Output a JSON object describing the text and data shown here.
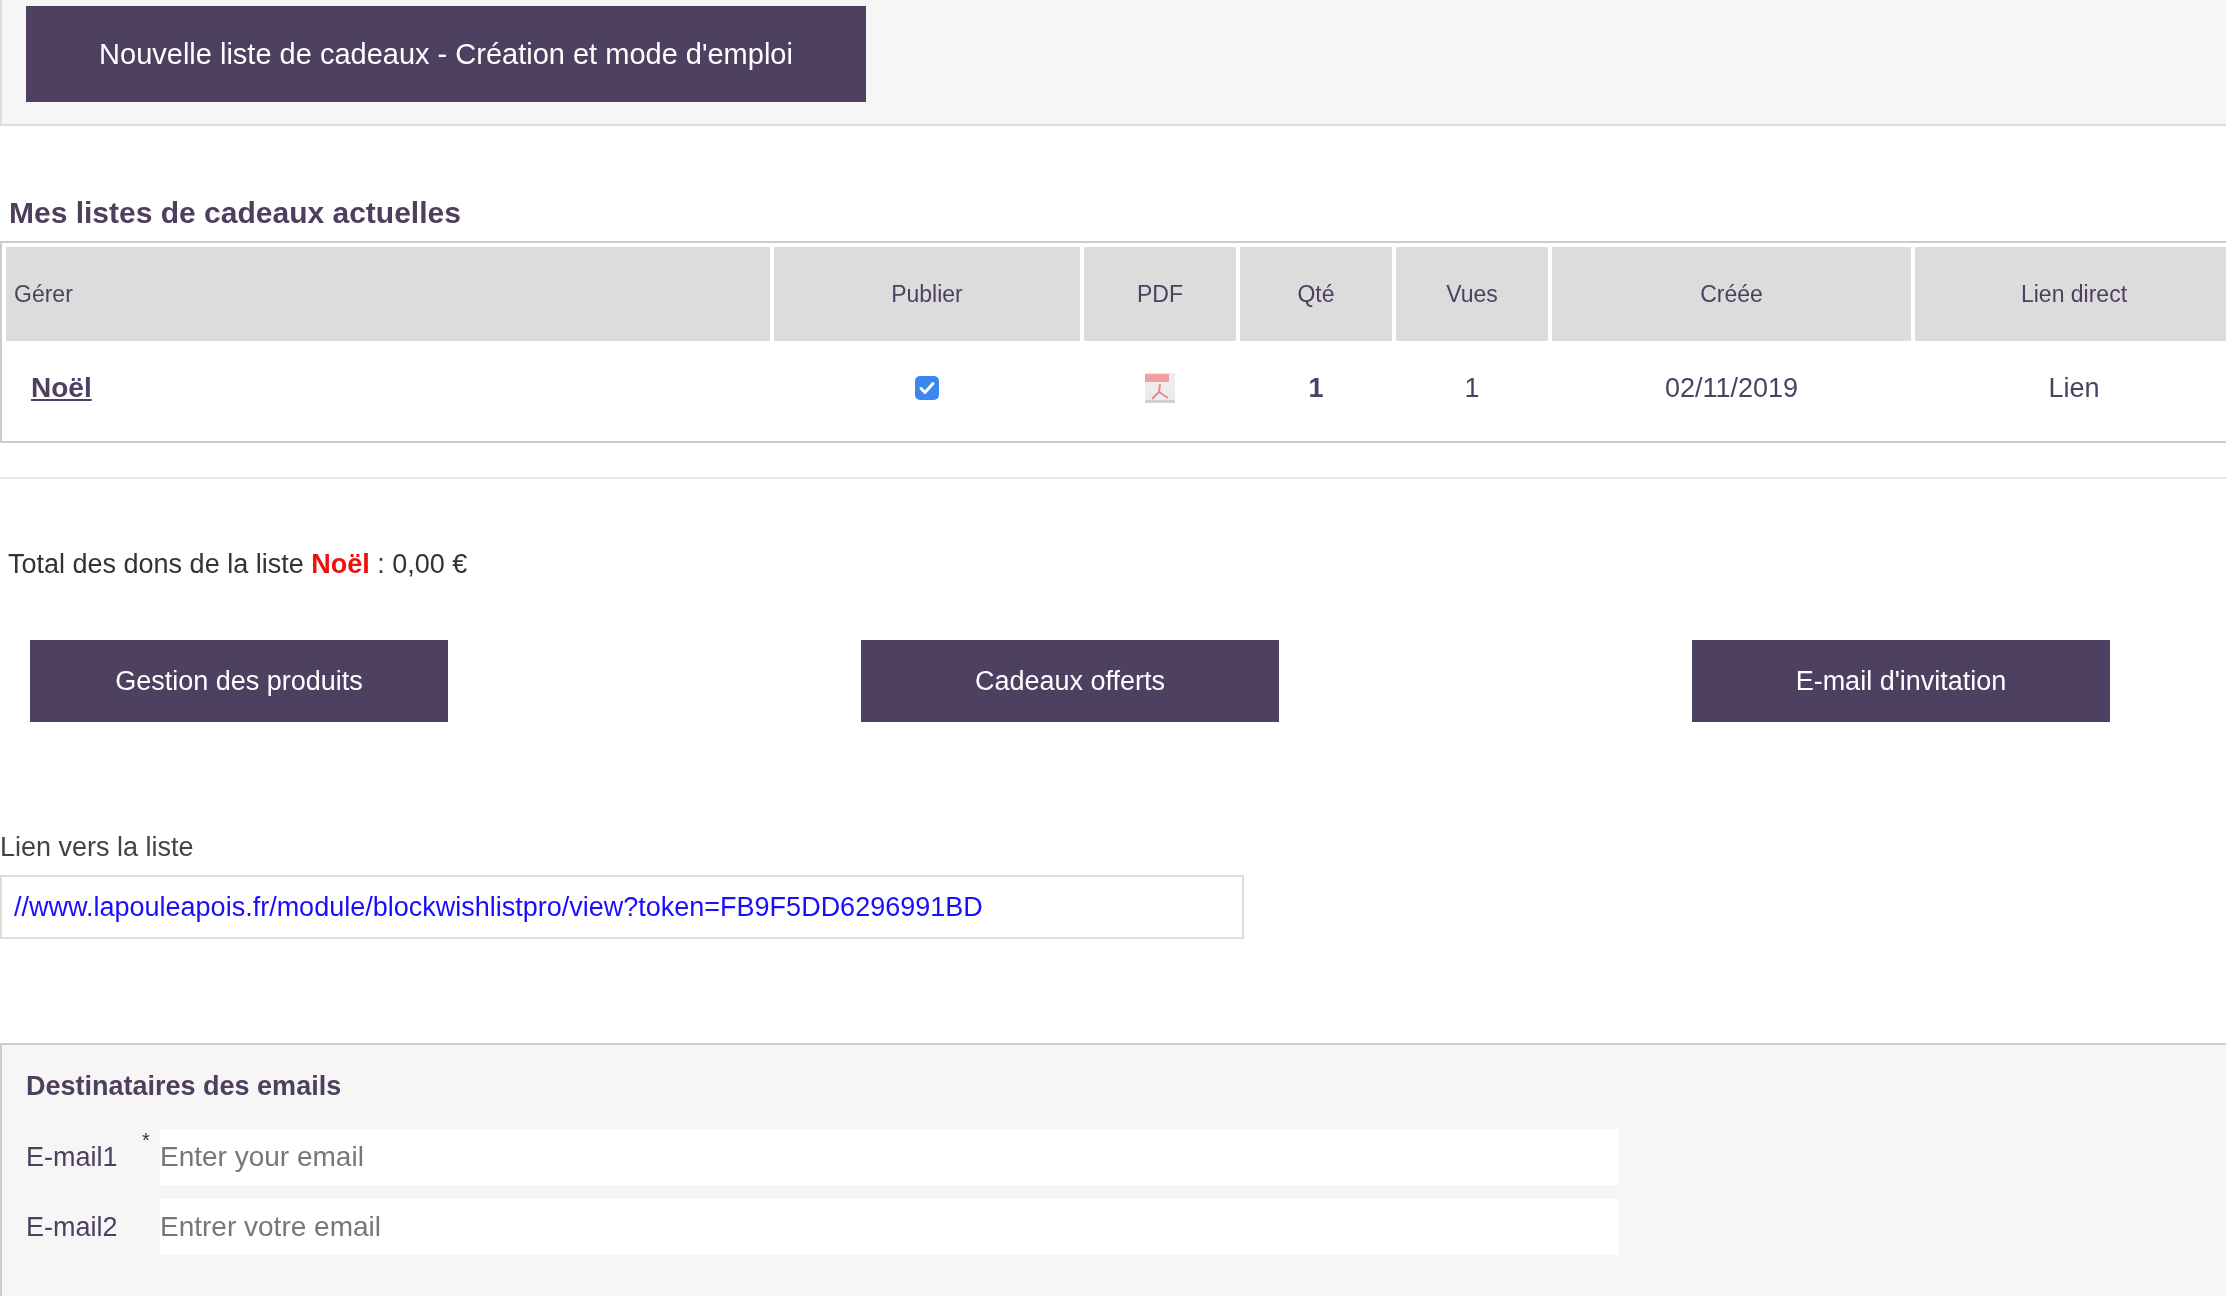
{
  "top_button": "Nouvelle liste de cadeaux - Création et mode d'emploi",
  "lists_title": "Mes listes de cadeaux actuelles",
  "table": {
    "columns": [
      "Gérer",
      "Publier",
      "PDF",
      "Qté",
      "Vues",
      "Créée",
      "Lien direct"
    ],
    "rows": [
      {
        "name": "Noël",
        "published": true,
        "qty": "1",
        "views": "1",
        "created": "02/11/2019",
        "link": "Lien"
      }
    ]
  },
  "total": "Total des dons de la liste **Noël** : 0,00 €",
  "actions": [
    "Gestion des produits",
    "Cadeaux offerts",
    "E-mail d'invitation"
  ],
  "link_label": "Lien vers la liste",
  "link_value": "//www.lapouleapois.fr/module/blockwishlistpro/view?token=FB9F5DD6296991BD",
  "recipients": {
    "title": "Destinataires des emails",
    "fields": [
      {
        "label": "E-mail1",
        "mark": "*",
        "placeholder": "Enter your email"
      },
      {
        "label": "E-mail2",
        "placeholder": "Entrer votre email"
      }
    ]
  }
}
